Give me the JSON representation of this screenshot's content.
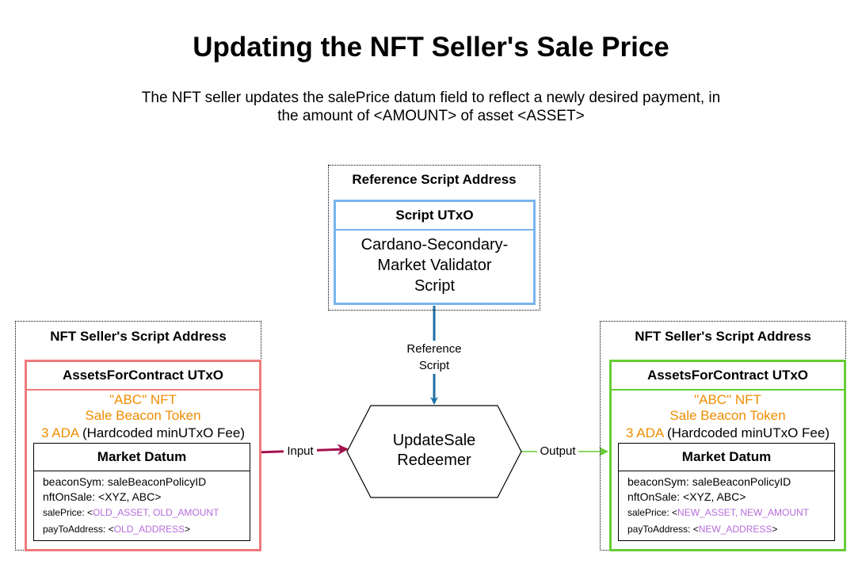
{
  "title": "Updating the NFT Seller's Sale Price",
  "subtitle_line1": "The NFT seller updates the salePrice datum field to reflect a newly desired payment, in",
  "subtitle_line2": "the amount of <AMOUNT> of asset <ASSET>",
  "reference": {
    "address_label": "Reference Script Address",
    "utxo_title": "Script UTxO",
    "script_line1": "Cardano-Secondary-",
    "script_line2": "Market Validator",
    "script_line3": "Script"
  },
  "edge_labels": {
    "reference_line1": "Reference",
    "reference_line2": "Script",
    "input": "Input",
    "output": "Output"
  },
  "redeemer": {
    "line1": "UpdateSale",
    "line2": "Redeemer"
  },
  "left": {
    "address_label": "NFT Seller's Script Address",
    "utxo_title": "AssetsForContract UTxO",
    "nft": "\"ABC\" NFT",
    "beacon": "Sale Beacon Token",
    "ada": "3 ADA",
    "ada_note": " (Hardcoded minUTxO Fee)",
    "datum_title": "Market Datum",
    "beacon_sym": "beaconSym: saleBeaconPolicyID",
    "nft_on_sale": "nftOnSale: <XYZ, ABC>",
    "sale_price_prefix": "salePrice: <",
    "sale_price_value": "OLD_ASSET, OLD_AMOUNT",
    "sale_price_suffix": "",
    "pay_prefix": "payToAddress: <",
    "pay_value": "OLD_ADDRESS",
    "pay_suffix": ">"
  },
  "right": {
    "address_label": "NFT Seller's Script Address",
    "utxo_title": "AssetsForContract UTxO",
    "nft": "\"ABC\" NFT",
    "beacon": "Sale Beacon Token",
    "ada": "3 ADA",
    "ada_note": " (Hardcoded minUTxO Fee)",
    "datum_title": "Market Datum",
    "beacon_sym": "beaconSym: saleBeaconPolicyID",
    "nft_on_sale": "nftOnSale: <XYZ, ABC>",
    "sale_price_prefix": "salePrice: <",
    "sale_price_value": "NEW_ASSET, NEW_AMOUNT",
    "sale_price_suffix": "",
    "pay_prefix": "payToAddress: <",
    "pay_value": "NEW_ADDRESS",
    "pay_suffix": ">"
  },
  "colors": {
    "script_border": "#78b4ec",
    "left_border": "#ef7b7b",
    "right_border": "#66cc33",
    "reference_arrow": "#1f6fa8",
    "input_arrow": "#a3124e",
    "output_arrow": "#66cc33",
    "asset_text": "#f08c00",
    "datum_value": "#b56cdb"
  }
}
